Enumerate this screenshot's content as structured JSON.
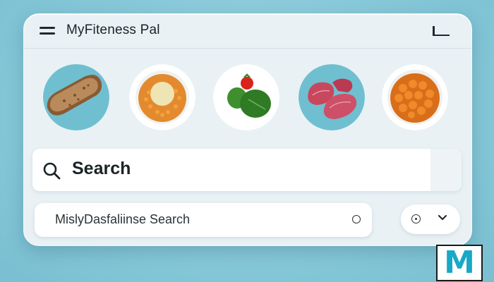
{
  "app": {
    "title": "MyFiteness Pal"
  },
  "foods": [
    {
      "name": "bread-slice",
      "background": "#6fbfd1"
    },
    {
      "name": "lentil-bowl",
      "background": "#ffffff"
    },
    {
      "name": "spinach-tomato",
      "background": "#ffffff"
    },
    {
      "name": "meat-slices",
      "background": "#6fbfd1"
    },
    {
      "name": "chickpea-bowl",
      "background": "#ffffff"
    }
  ],
  "search": {
    "label": "Search",
    "icon": "search-icon"
  },
  "secondary_search": {
    "value": "MislyDasfaliinse Search",
    "icon": "circle-icon"
  },
  "dropdown": {
    "icon": "clock-icon",
    "chevron": "chevron-down-icon"
  },
  "logo": {
    "letter": "M",
    "color": "#17a9c6"
  },
  "colors": {
    "background": "#86c8d8",
    "card": "#e9f1f4",
    "accent": "#17a9c6"
  }
}
